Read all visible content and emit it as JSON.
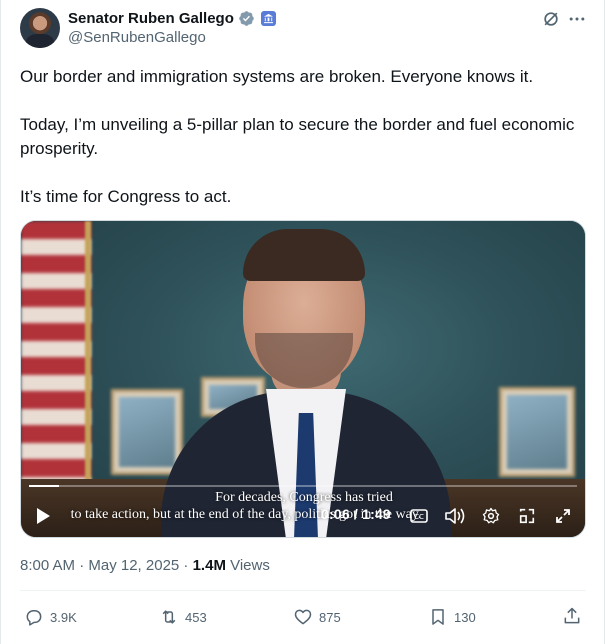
{
  "author": {
    "name": "Senator Ruben Gallego",
    "handle": "@SenRubenGallego"
  },
  "tweet": {
    "paragraphs": [
      "Our border and immigration systems are broken. Everyone knows it.",
      "Today, I’m unveiling a 5-pillar plan to secure the border and fuel economic prosperity.",
      "It’s time for Congress to act."
    ]
  },
  "video": {
    "caption_line1": "For decades, Congress has tried",
    "caption_line2": "to take action, but at the end of the day, politics got in the way.",
    "time": "0:06 / 1:49",
    "progress_fraction": 0.055
  },
  "meta": {
    "timestamp": "8:00 AM · May 12, 2025 · ",
    "views_count": "1.4M",
    "views_label": " Views"
  },
  "actions": {
    "replies": "3.9K",
    "reposts": "453",
    "likes": "875",
    "bookmarks": "130"
  },
  "colors": {
    "verified": "#829aab",
    "text_primary": "#0f1419",
    "text_secondary": "#536471"
  },
  "icons": [
    "verified-badge-icon",
    "government-badge-icon",
    "grok-icon",
    "more-icon",
    "play-icon",
    "captions-icon",
    "volume-icon",
    "settings-icon",
    "pip-icon",
    "fullscreen-icon",
    "reply-icon",
    "retweet-icon",
    "like-icon",
    "bookmark-icon",
    "share-icon"
  ]
}
